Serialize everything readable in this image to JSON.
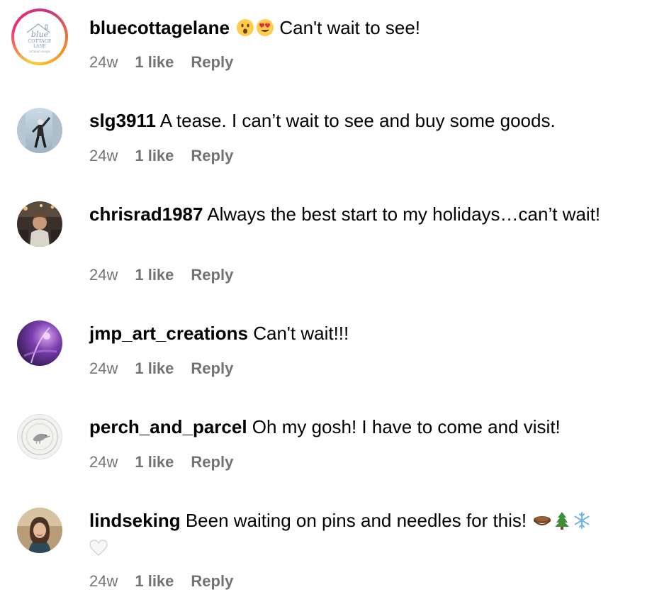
{
  "comments": [
    {
      "username": "bluecottagelane",
      "text": "Can't wait to see!",
      "emojis": [
        "astonished-face",
        "heart-eyes-face"
      ],
      "avatar": {
        "type": "logo",
        "lines": [
          "blue",
          "COTTAGE",
          "LANE",
          "artisan soaps"
        ]
      },
      "time": "24w",
      "likes": "1 like",
      "reply": "Reply"
    },
    {
      "username": "slg3911",
      "text": "A tease. I can’t wait to see and buy some goods.",
      "avatar": {
        "type": "photo",
        "description": "person-jumping"
      },
      "time": "24w",
      "likes": "1 like",
      "reply": "Reply"
    },
    {
      "username": "chrisrad1987",
      "text": "Always the best start to my holidays…can’t wait!",
      "avatar": {
        "type": "photo",
        "description": "person-portrait"
      },
      "time": "24w",
      "likes": "1 like",
      "reply": "Reply"
    },
    {
      "username": "jmp_art_creations",
      "text": "Can't wait!!!",
      "avatar": {
        "type": "photo",
        "description": "purple-artwork"
      },
      "time": "24w",
      "likes": "1 like",
      "reply": "Reply"
    },
    {
      "username": "perch_and_parcel",
      "text": "Oh my gosh! I have to come and visit!",
      "avatar": {
        "type": "logo",
        "description": "bird-seal"
      },
      "time": "24w",
      "likes": "1 like",
      "reply": "Reply"
    },
    {
      "username": "lindseking",
      "text": "Been waiting on pins and needles for this!",
      "emojis": [
        "pie",
        "christmas-tree",
        "snowflake",
        "white-heart"
      ],
      "avatar": {
        "type": "photo",
        "description": "woman-portrait"
      },
      "time": "24w",
      "likes": "1 like",
      "reply": "Reply"
    }
  ]
}
